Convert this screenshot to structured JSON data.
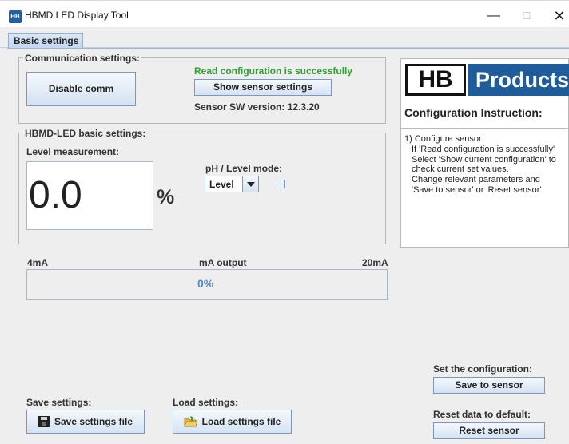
{
  "window": {
    "title": "HBMD LED Display Tool",
    "app_icon_text": "HB",
    "minimize_glyph": "—",
    "maximize_glyph": "☐",
    "close_glyph": "✕"
  },
  "tabs": [
    {
      "label": "Basic settings",
      "active": true
    }
  ],
  "communication": {
    "label": "Communication settings:",
    "disable_button": "Disable comm",
    "status_text": "Read configuration is successfully",
    "show_sensor_button": "Show sensor settings",
    "sw_version_text": "Sensor SW version: 12.3.20"
  },
  "basic": {
    "label": "HBMD-LED basic settings:",
    "level_label": "Level measurement:",
    "level_value": "0.0",
    "level_unit": "%",
    "mode_label": "pH / Level mode:",
    "mode_selected": "Level",
    "mode_checkbox_checked": false
  },
  "output": {
    "min_label": "4mA",
    "title": "mA output",
    "max_label": "20mA",
    "progress_text": "0%",
    "progress_fraction": 0.0
  },
  "instructions": {
    "logo_left": "HB",
    "logo_right": "Products",
    "title": "Configuration Instruction:",
    "lines": [
      "1) Configure sensor:",
      "If 'Read configuration is successfully'",
      "Select 'Show current configuration' to",
      "check current set values.",
      "Change relevant parameters and",
      "'Save to sensor' or 'Reset sensor'"
    ]
  },
  "save": {
    "label": "Save settings:",
    "button": "Save settings file",
    "icon": "floppy-disk-icon"
  },
  "load": {
    "label": "Load settings:",
    "button": "Load settings file",
    "icon": "folder-open-icon"
  },
  "configuration": {
    "label": "Set the configuration:",
    "save_button": "Save to sensor"
  },
  "reset": {
    "label": "Reset data to default:",
    "button": "Reset sensor"
  },
  "colors": {
    "accent": "#1e5c9c",
    "success": "#2ea12e",
    "progress_text": "#5a87c4"
  }
}
